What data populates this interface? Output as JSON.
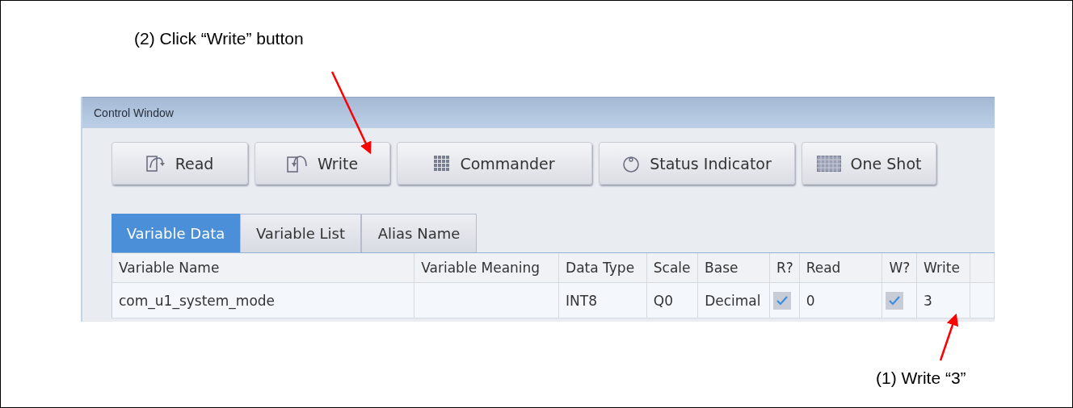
{
  "annotations": [
    {
      "kind": "top",
      "text": "(2) Click “Write” button"
    },
    {
      "kind": "bottom",
      "text": "(1) Write “3”"
    }
  ],
  "window": {
    "title": "Control Window"
  },
  "toolbar": [
    {
      "kind": "read",
      "label": "Read"
    },
    {
      "kind": "write",
      "label": "Write"
    },
    {
      "kind": "grid",
      "label": "Commander"
    },
    {
      "kind": "dial",
      "label": "Status Indicator"
    },
    {
      "kind": "table",
      "label": "One Shot"
    }
  ],
  "tabs": [
    {
      "label": "Variable Data",
      "selected": true
    },
    {
      "label": "Variable List",
      "selected": false
    },
    {
      "label": "Alias Name",
      "selected": false
    }
  ],
  "table": {
    "columns": [
      "Variable Name",
      "Variable Meaning",
      "Data Type",
      "Scale",
      "Base",
      "R?",
      "Read",
      "W?",
      "Write"
    ],
    "rows": [
      {
        "variable_name": "com_u1_system_mode",
        "data_type": "INT8",
        "scale": "Q0",
        "base": "Decimal",
        "read_checked": true,
        "read": "0",
        "write_checked": true,
        "write": "3"
      }
    ]
  }
}
